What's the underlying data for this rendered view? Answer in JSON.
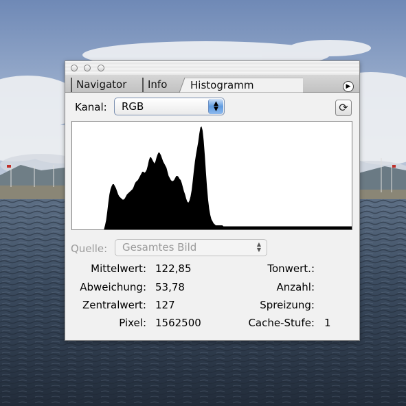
{
  "panel": {
    "tabs": [
      {
        "label": "Navigator"
      },
      {
        "label": "Info"
      },
      {
        "label": "Histogramm"
      }
    ]
  },
  "channel": {
    "label": "Kanal:",
    "value": "RGB"
  },
  "source": {
    "label": "Quelle:",
    "value": "Gesamtes Bild"
  },
  "histogram": {
    "levels": [
      0,
      0,
      0,
      0,
      0,
      0,
      0,
      0,
      0,
      0,
      0,
      0,
      0,
      0,
      0,
      0,
      0,
      0,
      0,
      0,
      0,
      0,
      0,
      0,
      0,
      0,
      0,
      0,
      0,
      0,
      0.04,
      0.09,
      0.17,
      0.26,
      0.34,
      0.39,
      0.42,
      0.44,
      0.44,
      0.42,
      0.4,
      0.37,
      0.34,
      0.32,
      0.31,
      0.3,
      0.29,
      0.29,
      0.3,
      0.32,
      0.34,
      0.35,
      0.36,
      0.37,
      0.38,
      0.39,
      0.41,
      0.44,
      0.46,
      0.47,
      0.48,
      0.5,
      0.52,
      0.54,
      0.56,
      0.56,
      0.55,
      0.56,
      0.58,
      0.62,
      0.67,
      0.7,
      0.7,
      0.68,
      0.66,
      0.64,
      0.66,
      0.7,
      0.73,
      0.75,
      0.74,
      0.72,
      0.69,
      0.66,
      0.64,
      0.62,
      0.6,
      0.56,
      0.52,
      0.5,
      0.48,
      0.47,
      0.47,
      0.48,
      0.5,
      0.52,
      0.52,
      0.51,
      0.49,
      0.48,
      0.45,
      0.41,
      0.37,
      0.34,
      0.3,
      0.27,
      0.26,
      0.28,
      0.32,
      0.38,
      0.47,
      0.57,
      0.66,
      0.73,
      0.79,
      0.85,
      0.93,
      0.99,
      1.0,
      0.96,
      0.86,
      0.72,
      0.56,
      0.41,
      0.29,
      0.2,
      0.14,
      0.1,
      0.08,
      0.06,
      0.05,
      0.04,
      0.04,
      0.04,
      0.04,
      0.04,
      0.04,
      0.04,
      0.03,
      0.03,
      0.03,
      0.03,
      0.03,
      0.03,
      0.03,
      0.03,
      0.03,
      0.03,
      0.03,
      0.03,
      0.03,
      0.03,
      0.03,
      0.03,
      0.03,
      0.03,
      0.03,
      0.03,
      0.03,
      0.03,
      0.03,
      0.03,
      0.03,
      0.03,
      0.03,
      0.03,
      0.03,
      0.03,
      0.03,
      0.03,
      0.03,
      0.03,
      0.03,
      0.03,
      0.03,
      0.03,
      0.03,
      0.03,
      0.03,
      0.03,
      0.03,
      0.03,
      0.03,
      0.03,
      0.03,
      0.03,
      0.03,
      0.03,
      0.03,
      0.03,
      0.03,
      0.03,
      0.03,
      0.03,
      0.03,
      0.03,
      0.03,
      0.03,
      0.03,
      0.03,
      0.03,
      0.03,
      0.03,
      0.03,
      0.03,
      0.03,
      0.03,
      0.03,
      0.03,
      0.03,
      0.03,
      0.03,
      0.03,
      0.03,
      0.03,
      0.03,
      0.03,
      0.03,
      0.03,
      0.03,
      0.03,
      0.03,
      0.03,
      0.03,
      0.03,
      0.03,
      0.03,
      0.03,
      0.03,
      0.03,
      0.03,
      0.03,
      0.03,
      0.03,
      0.03,
      0.03,
      0.03,
      0.03,
      0.03,
      0.03,
      0.03,
      0.03,
      0.03,
      0.03,
      0.03,
      0.03,
      0.03,
      0.03,
      0.03,
      0.03,
      0.03,
      0.03,
      0.03,
      0.03,
      0.03,
      0.03
    ]
  },
  "stats": {
    "mittelwert": {
      "label": "Mittelwert:",
      "value": "122,85"
    },
    "abweichung": {
      "label": "Abweichung:",
      "value": "53,78"
    },
    "zentralwert": {
      "label": "Zentralwert:",
      "value": "127"
    },
    "pixel": {
      "label": "Pixel:",
      "value": "1562500"
    },
    "tonwert": {
      "label": "Tonwert.:",
      "value": ""
    },
    "anzahl": {
      "label": "Anzahl:",
      "value": ""
    },
    "spreizung": {
      "label": "Spreizung:",
      "value": ""
    },
    "cache": {
      "label": "Cache-Stufe:",
      "value": "1"
    }
  },
  "colors": {
    "sky": "#7f97bd",
    "water": "#3a4a5c",
    "histogram": "#000000"
  }
}
